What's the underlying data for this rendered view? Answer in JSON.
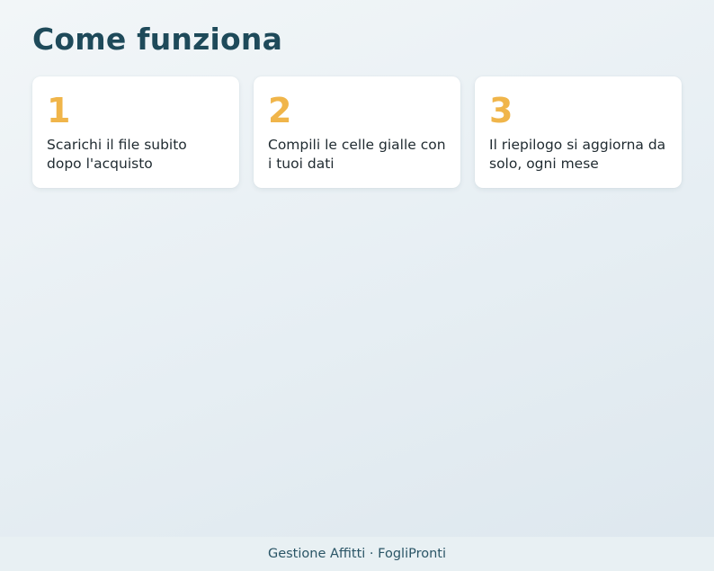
{
  "page": {
    "title": "Come funziona"
  },
  "colors": {
    "accent": "#f0b54a",
    "title": "#1e4a5a"
  },
  "steps": [
    {
      "number": "1",
      "text": "Scarichi il file subito dopo l'acquisto"
    },
    {
      "number": "2",
      "text": "Compili le celle gialle con i tuoi dati"
    },
    {
      "number": "3",
      "text": "Il riepilogo si aggiorna da solo, ogni mese"
    }
  ],
  "footer": {
    "text": "Gestione Affitti · FogliPronti"
  }
}
